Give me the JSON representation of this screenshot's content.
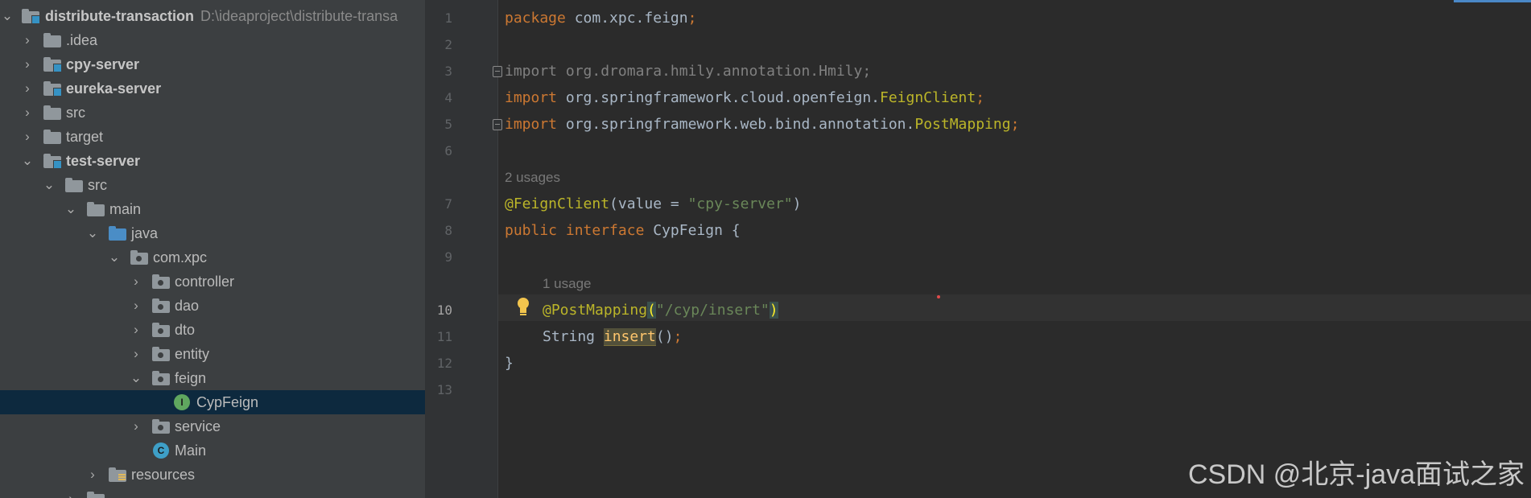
{
  "project_tree": {
    "items": [
      {
        "label": "distribute-transaction",
        "path": "D:\\ideaproject\\distribute-transa",
        "expanded": true,
        "icon": "module-folder-icon",
        "bold": true
      },
      {
        "label": ".idea",
        "expanded": false,
        "icon": "folder-icon"
      },
      {
        "label": "cpy-server",
        "expanded": false,
        "icon": "module-folder-icon",
        "bold": true
      },
      {
        "label": "eureka-server",
        "expanded": false,
        "icon": "module-folder-icon",
        "bold": true
      },
      {
        "label": "src",
        "expanded": false,
        "icon": "folder-icon"
      },
      {
        "label": "target",
        "expanded": false,
        "icon": "folder-icon"
      },
      {
        "label": "test-server",
        "expanded": true,
        "icon": "module-folder-icon",
        "bold": true
      },
      {
        "label": "src",
        "expanded": true,
        "icon": "folder-icon"
      },
      {
        "label": "main",
        "expanded": true,
        "icon": "folder-icon"
      },
      {
        "label": "java",
        "expanded": true,
        "icon": "source-root-folder-icon"
      },
      {
        "label": "com.xpc",
        "expanded": true,
        "icon": "package-icon"
      },
      {
        "label": "controller",
        "expanded": false,
        "icon": "package-icon"
      },
      {
        "label": "dao",
        "expanded": false,
        "icon": "package-icon"
      },
      {
        "label": "dto",
        "expanded": false,
        "icon": "package-icon"
      },
      {
        "label": "entity",
        "expanded": false,
        "icon": "package-icon"
      },
      {
        "label": "feign",
        "expanded": true,
        "icon": "package-icon"
      },
      {
        "label": "CypFeign",
        "icon": "interface-icon",
        "icon_letter": "I",
        "selected": true
      },
      {
        "label": "service",
        "expanded": false,
        "icon": "package-icon"
      },
      {
        "label": "Main",
        "icon": "class-icon",
        "icon_letter": "C"
      },
      {
        "label": "resources",
        "expanded": false,
        "icon": "resources-folder-icon"
      }
    ]
  },
  "editor": {
    "line_numbers": [
      "1",
      "2",
      "3",
      "4",
      "5",
      "6",
      "7",
      "8",
      "9",
      "10",
      "11",
      "12",
      "13"
    ],
    "current_line": "10",
    "hints": {
      "class_usages": "2 usages",
      "method_usages": "1 usage"
    },
    "lines": {
      "l1": {
        "kw": "package",
        "rest": " com.xpc.feign",
        "semi": ";"
      },
      "l3": {
        "kw": "import",
        "rest": " org.dromara.hmily.annotation.Hmily;"
      },
      "l4": {
        "kw": "import",
        "rest": " org.springframework.cloud.openfeign.",
        "cls": "FeignClient",
        "semi": ";"
      },
      "l5": {
        "kw": "import",
        "rest": " org.springframework.web.bind.annotation.",
        "cls": "PostMapping",
        "semi": ";"
      },
      "l7": {
        "ann": "@FeignClient",
        "open": "(value = ",
        "str": "\"cpy-server\"",
        "close": ")"
      },
      "l8": {
        "kw1": "public",
        "kw2": " interface",
        "rest": " CypFeign {"
      },
      "l10": {
        "ann": "@PostMapping",
        "open": "(",
        "str": "\"/cyp/insert\"",
        "close": ")"
      },
      "l11": {
        "type": "String ",
        "method": "insert",
        "rest": "()",
        "semi": ";"
      },
      "l12": {
        "rest": "}"
      }
    }
  },
  "watermark": "CSDN @北京-java面试之家"
}
